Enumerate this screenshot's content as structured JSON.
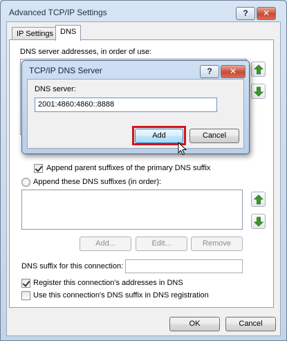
{
  "window": {
    "title": "Advanced TCP/IP Settings",
    "help_label": "?",
    "close_label": "✕"
  },
  "tabs": [
    {
      "label": "IP Settings",
      "active": false
    },
    {
      "label": "DNS",
      "active": true
    }
  ],
  "dns": {
    "servers_label": "DNS server addresses, in order of use:",
    "append_parent_label": "Append parent suffixes of the primary DNS suffix",
    "append_parent_checked": true,
    "append_these_label": "Append these DNS suffixes (in order):",
    "suffix_buttons": {
      "add": "Add...",
      "edit": "Edit...",
      "remove": "Remove"
    },
    "connection_suffix_label": "DNS suffix for this connection:",
    "connection_suffix_value": "",
    "register_label": "Register this connection's addresses in DNS",
    "register_checked": true,
    "use_suffix_label": "Use this connection's DNS suffix in DNS registration",
    "use_suffix_checked": false
  },
  "footer": {
    "ok": "OK",
    "cancel": "Cancel"
  },
  "modal": {
    "title": "TCP/IP DNS Server",
    "help_label": "?",
    "close_label": "✕",
    "field_label": "DNS server:",
    "field_value": "2001:4860:4860::8888",
    "add": "Add",
    "cancel": "Cancel"
  },
  "colors": {
    "highlight": "#d3141a",
    "arrow_green": "#3a9a2a"
  }
}
